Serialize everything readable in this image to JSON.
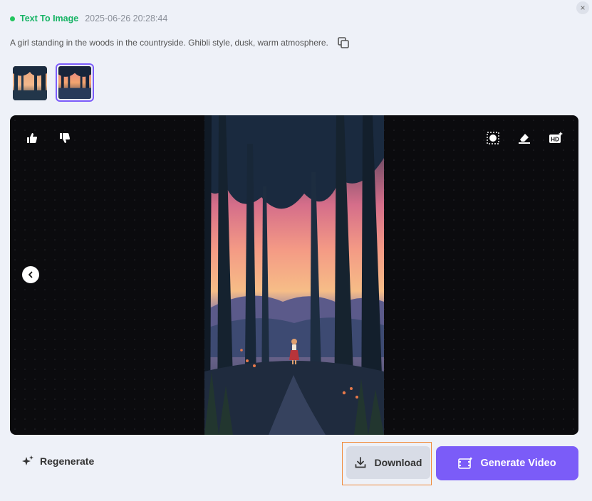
{
  "header": {
    "mode_label": "Text To Image",
    "timestamp": "2025-06-26 20:28:44"
  },
  "prompt": {
    "text": "A girl standing in the woods in the countryside. Ghibli style, dusk, warm atmosphere."
  },
  "thumbnails": [
    {
      "selected": false
    },
    {
      "selected": true
    }
  ],
  "viewer": {
    "left_icons": [
      "thumbs-up-icon",
      "thumbs-down-icon"
    ],
    "right_icons": [
      "background-remove-icon",
      "eraser-icon",
      "hd-upscale-icon"
    ],
    "nav_icon": "chevron-left-icon"
  },
  "actions": {
    "regenerate_label": "Regenerate",
    "download_label": "Download",
    "generate_video_label": "Generate Video"
  },
  "colors": {
    "accent": "#7b5cf8",
    "status": "#22c55e",
    "focus": "#f08a3a"
  }
}
